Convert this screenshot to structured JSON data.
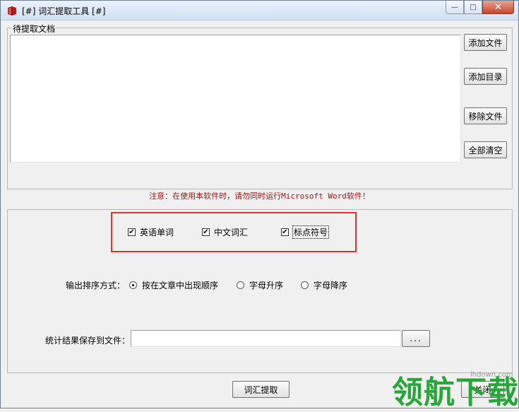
{
  "window": {
    "title": "[#] 词汇提取工具 [#]",
    "caption_minimize": "—",
    "caption_maximize": "□",
    "caption_close": "✕",
    "accent_color": "#c8442b"
  },
  "documents": {
    "group_label": "待提取文档",
    "add_file": "添加文件",
    "add_folder": "添加目录",
    "remove_file": "移除文件",
    "clear_all": "全部清空"
  },
  "notice": {
    "text": "注意：在使用本软件时，请勿同时运行Microsoft Word软件！",
    "color": "#a31515"
  },
  "options": {
    "english_words": {
      "label": "英语单词",
      "checked": true
    },
    "chinese_words": {
      "label": "中文词汇",
      "checked": true
    },
    "punctuation": {
      "label": "标点符号",
      "checked": true
    },
    "highlight_color": "#e0342f"
  },
  "sort": {
    "label": "输出排序方式：",
    "options": [
      "按在文章中出现顺序",
      "字母升序",
      "字母降序"
    ],
    "selected": "按在文章中出现顺序"
  },
  "output": {
    "label": "统计结果保存到文件：",
    "path_value": "",
    "browse": "..."
  },
  "actions": {
    "extract": "词汇提取",
    "close": "关闭"
  },
  "watermark": {
    "text": "领航下载",
    "url": "lhdown.com"
  },
  "check_mark": "✔"
}
